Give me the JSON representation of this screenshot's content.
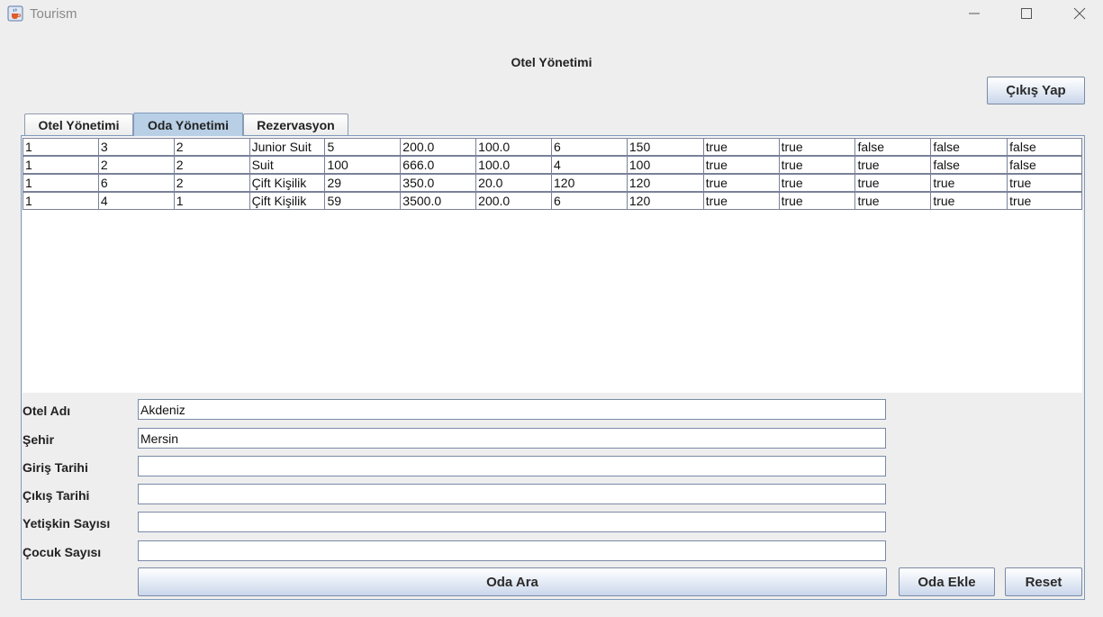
{
  "window": {
    "title": "Tourism",
    "icon": "java-cup-icon"
  },
  "header": {
    "title": "Otel Yönetimi",
    "logout_label": "Çıkış Yap"
  },
  "tabs": [
    {
      "label": "Otel Yönetimi",
      "selected": false
    },
    {
      "label": "Oda Yönetimi",
      "selected": true
    },
    {
      "label": "Rezervasyon",
      "selected": false
    }
  ],
  "table": {
    "rows": [
      [
        "1",
        "3",
        "2",
        "Junior Suit",
        "5",
        "200.0",
        "100.0",
        "6",
        "150",
        "true",
        "true",
        "false",
        "false",
        "false"
      ],
      [
        "1",
        "2",
        "2",
        "Suit",
        "100",
        "666.0",
        "100.0",
        "4",
        "100",
        "true",
        "true",
        "true",
        "false",
        "false"
      ],
      [
        "1",
        "6",
        "2",
        "Çift Kişilik",
        "29",
        "350.0",
        "20.0",
        "120",
        "120",
        "true",
        "true",
        "true",
        "true",
        "true"
      ],
      [
        "1",
        "4",
        "1",
        "Çift Kişilik",
        "59",
        "3500.0",
        "200.0",
        "6",
        "120",
        "true",
        "true",
        "true",
        "true",
        "true"
      ]
    ]
  },
  "form": {
    "hotel_name": {
      "label": "Otel Adı",
      "value": "Akdeniz"
    },
    "city": {
      "label": "Şehir",
      "value": "Mersin"
    },
    "checkin": {
      "label": "Giriş Tarihi",
      "value": ""
    },
    "checkout": {
      "label": "Çıkış Tarihi",
      "value": ""
    },
    "adults": {
      "label": "Yetişkin Sayısı",
      "value": ""
    },
    "children": {
      "label": "Çocuk Sayısı",
      "value": ""
    }
  },
  "actions": {
    "search_label": "Oda Ara",
    "add_label": "Oda Ekle",
    "reset_label": "Reset"
  }
}
